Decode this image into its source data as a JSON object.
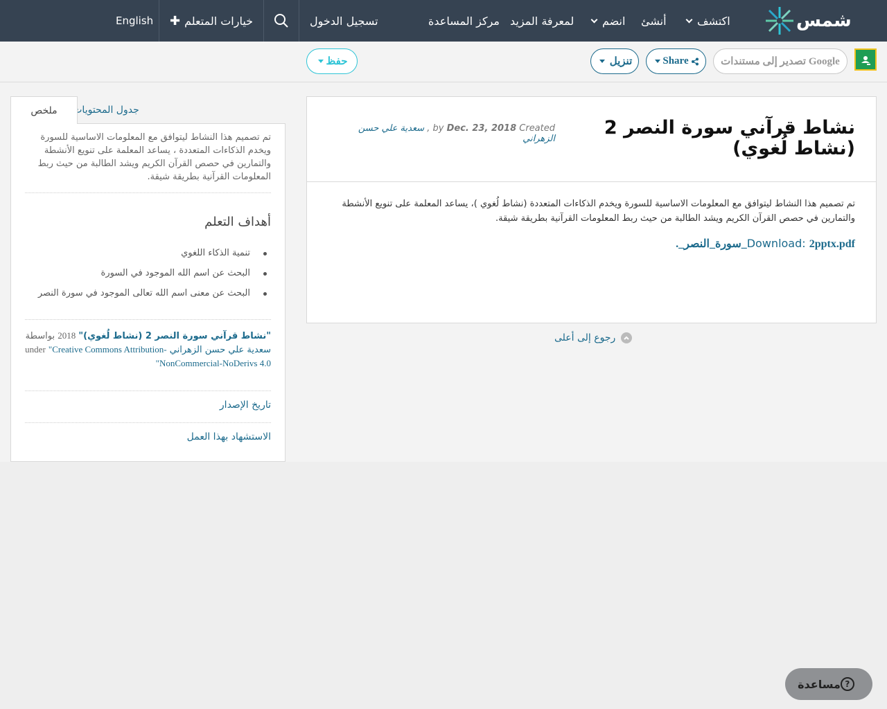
{
  "navbar": {
    "logo_text": "شمس",
    "explore": "اكتشف",
    "create": "أنشئ",
    "join": "انضم",
    "learn_more": "لمعرفة المزيد",
    "help_center": "مركز المساعدة",
    "login": "تسجيل الدخول",
    "learner_options": "خيارات المتعلم",
    "language": "English"
  },
  "toolbar": {
    "export_google": "تصدير إلى مستندات Google",
    "share": "Share",
    "download": "تنزيل",
    "save": "حفظ"
  },
  "resource": {
    "title": "نشاط قرآني سورة النصر 2 (نشاط لُغوي)",
    "by_label": "by",
    "date": "Dec. 23, 2018",
    "created_label": "Created",
    "author": "سعدية علي حسن الزهراني",
    "description": "تم تصميم هذا النشاط ليتوافق مع المعلومات الاساسية للسورة ويخدم الذكاءات المتعددة (نشاط لُغوي )، يساعد المعلمة على تنويع الأنشطة والتمارين في حصص القرآن الكريم ويشد الطالبة من حيث ربط المعلومات القرآنية بطريقة شيقة.",
    "download_label": "Download:",
    "download_file": "2pptx.pdf_سورة_النصر_."
  },
  "back_to_top": "رجوع إلى أعلى",
  "sidebar": {
    "tab_summary": "ملخص",
    "tab_contents": "جدول المحتويات",
    "summary": "تم تصميم هذا النشاط ليتوافق مع المعلومات الاساسية للسورة ويخدم الذكاءات المتعددة ، يساعد المعلمة على تنويع الأنشطة والتمارين في حصص القرآن الكريم ويشد الطالبة من حيث ربط المعلومات القرآنية بطريقة شيقة.",
    "goals_heading": "أهداف التعلم",
    "goals": [
      "تنمية الذكاء اللغوي",
      "البحث عن اسم الله الموجود في السورة",
      "البحث عن معنى اسم الله تعالى الموجود في سورة النصر"
    ],
    "license": {
      "work_title": "\"نشاط قرآني سورة النصر 2 (نشاط لُغوي)\"",
      "year": "2018",
      "by": "بواسطة",
      "author": "سعدية علي حسن الزهراني",
      "under": "under",
      "license_name": "\"Creative Commons Attribution-NonCommercial-NoDerivs 4.0\""
    },
    "version_history": "تاريخ الإصدار",
    "cite": "الاستشهاد بهذا العمل"
  },
  "help_button": "مساعدة",
  "colors": {
    "navbar": "#364352",
    "link": "#1b6a8c",
    "teal": "#2ec4d6"
  }
}
